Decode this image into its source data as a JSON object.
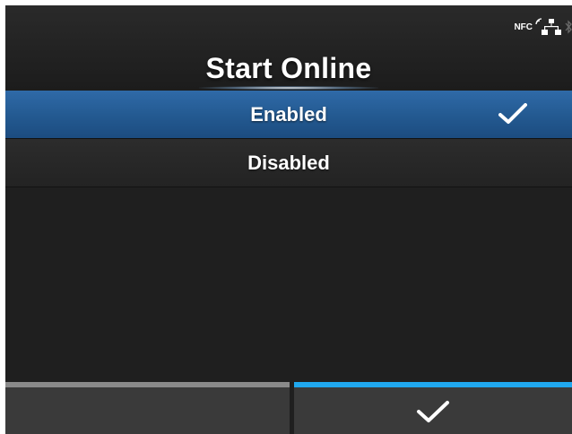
{
  "screen": {
    "title": "Start Online"
  },
  "status_bar": {
    "icons": [
      "nfc-icon",
      "network-icon",
      "bluetooth-icon"
    ],
    "nfc_label": "NFC"
  },
  "options": [
    {
      "label": "Enabled",
      "selected": true
    },
    {
      "label": "Disabled",
      "selected": false
    }
  ],
  "footer": {
    "left_button_icon": "none",
    "right_button_icon": "check-icon"
  },
  "colors": {
    "selected_row": "#2a639e",
    "accent": "#20a8ef",
    "background": "#1f1f1f",
    "text": "#ffffff"
  }
}
